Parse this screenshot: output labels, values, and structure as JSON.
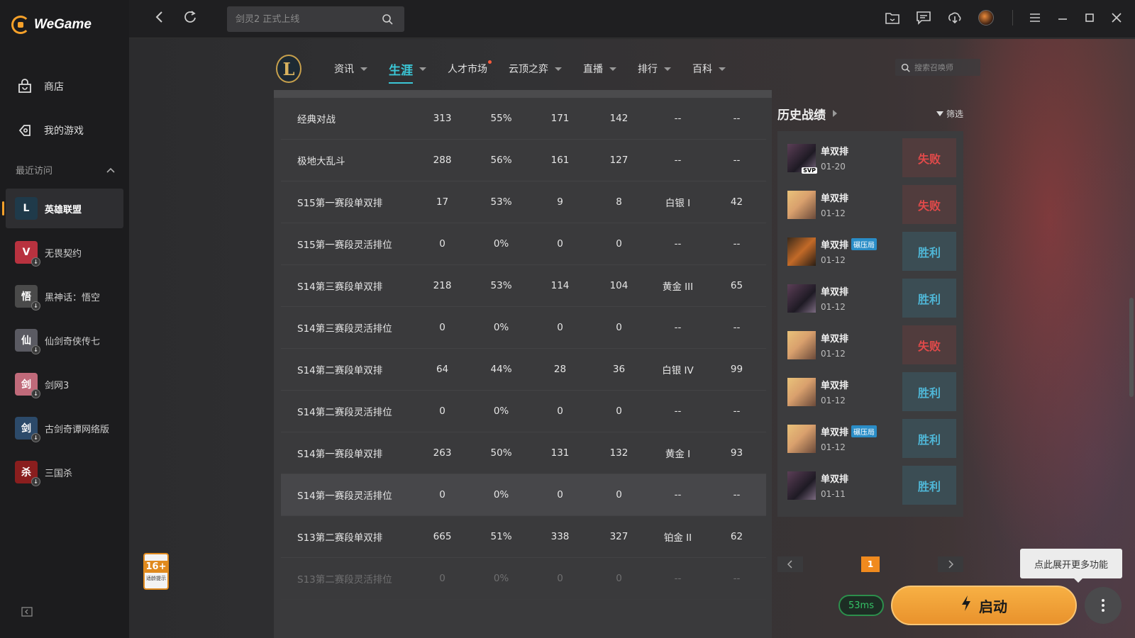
{
  "app": {
    "name": "WeGame"
  },
  "sidebar": {
    "nav": [
      {
        "label": "商店",
        "icon": "store-bag-icon"
      },
      {
        "label": "我的游戏",
        "icon": "games-icon"
      }
    ],
    "recent_label": "最近访问",
    "recent": [
      {
        "label": "英雄联盟",
        "glyph": "L",
        "color": "#1f3a4a",
        "active": true
      },
      {
        "label": "无畏契约",
        "glyph": "V",
        "color": "#b8323f"
      },
      {
        "label": "黑神话：悟空",
        "glyph": "悟",
        "color": "#4a4a4a"
      },
      {
        "label": "仙剑奇侠传七",
        "glyph": "仙",
        "color": "#5a5a62"
      },
      {
        "label": "剑网3",
        "glyph": "剑",
        "color": "#c06a7a"
      },
      {
        "label": "古剑奇谭网络版",
        "glyph": "剑",
        "color": "#2c4a6a"
      },
      {
        "label": "三国杀",
        "glyph": "杀",
        "color": "#8a1e1e"
      }
    ],
    "age_rating": {
      "number": "16+",
      "text": "适龄提示"
    }
  },
  "topbar": {
    "search_placeholder": "剑灵2 正式上线"
  },
  "game_nav": {
    "logo_glyph": "L",
    "tabs": [
      {
        "label": "资讯",
        "active": false,
        "dot": false
      },
      {
        "label": "生涯",
        "active": true,
        "dot": false
      },
      {
        "label": "人才市场",
        "active": false,
        "dot": true,
        "no_caret": true
      },
      {
        "label": "云顶之弈",
        "active": false,
        "dot": false
      },
      {
        "label": "直播",
        "active": false,
        "dot": false
      },
      {
        "label": "排行",
        "active": false,
        "dot": false
      },
      {
        "label": "百科",
        "active": false,
        "dot": false
      }
    ],
    "summoner_search_placeholder": "搜索召唤师"
  },
  "stats_table": {
    "rows": [
      [
        "经典对战",
        "313",
        "55%",
        "171",
        "142",
        "--",
        "--"
      ],
      [
        "极地大乱斗",
        "288",
        "56%",
        "161",
        "127",
        "--",
        "--"
      ],
      [
        "S15第一赛段单双排",
        "17",
        "53%",
        "9",
        "8",
        "白银 I",
        "42"
      ],
      [
        "S15第一赛段灵活排位",
        "0",
        "0%",
        "0",
        "0",
        "--",
        "--"
      ],
      [
        "S14第三赛段单双排",
        "218",
        "53%",
        "114",
        "104",
        "黄金 III",
        "65"
      ],
      [
        "S14第三赛段灵活排位",
        "0",
        "0%",
        "0",
        "0",
        "--",
        "--"
      ],
      [
        "S14第二赛段单双排",
        "64",
        "44%",
        "28",
        "36",
        "白银 IV",
        "99"
      ],
      [
        "S14第二赛段灵活排位",
        "0",
        "0%",
        "0",
        "0",
        "--",
        "--"
      ],
      [
        "S14第一赛段单双排",
        "263",
        "50%",
        "131",
        "132",
        "黄金 I",
        "93"
      ],
      [
        "S14第一赛段灵活排位",
        "0",
        "0%",
        "0",
        "0",
        "--",
        "--"
      ],
      [
        "S13第二赛段单双排",
        "665",
        "51%",
        "338",
        "327",
        "铂金 II",
        "62"
      ],
      [
        "S13第二赛段灵活排位",
        "0",
        "0%",
        "0",
        "0",
        "--",
        "--"
      ]
    ]
  },
  "history": {
    "title": "历史战绩",
    "filter_label": "筛选",
    "matches": [
      {
        "mode": "单双排",
        "date": "01-20",
        "result": "失败",
        "win": false,
        "champ": "dark",
        "badge": "SVP",
        "tag": ""
      },
      {
        "mode": "单双排",
        "date": "01-12",
        "result": "失败",
        "win": false,
        "champ": "blond",
        "badge": "",
        "tag": ""
      },
      {
        "mode": "单双排",
        "date": "01-12",
        "result": "胜利",
        "win": true,
        "champ": "fire",
        "badge": "",
        "tag": "碾压局"
      },
      {
        "mode": "单双排",
        "date": "01-12",
        "result": "胜利",
        "win": true,
        "champ": "dark",
        "badge": "",
        "tag": ""
      },
      {
        "mode": "单双排",
        "date": "01-12",
        "result": "失败",
        "win": false,
        "champ": "blond",
        "badge": "",
        "tag": ""
      },
      {
        "mode": "单双排",
        "date": "01-12",
        "result": "胜利",
        "win": true,
        "champ": "blond",
        "badge": "",
        "tag": ""
      },
      {
        "mode": "单双排",
        "date": "01-12",
        "result": "胜利",
        "win": true,
        "champ": "blond",
        "badge": "",
        "tag": "碾压局"
      },
      {
        "mode": "单双排",
        "date": "01-11",
        "result": "胜利",
        "win": true,
        "champ": "dark",
        "badge": "",
        "tag": ""
      }
    ],
    "page": "1"
  },
  "footer": {
    "tooltip": "点此展开更多功能",
    "ping": "53ms",
    "launch_label": "启动"
  },
  "colors": {
    "accent": "#f7a12a",
    "tab_active": "#3bc7d7",
    "win": "#4fb6d6",
    "lose": "#e14a4a"
  }
}
